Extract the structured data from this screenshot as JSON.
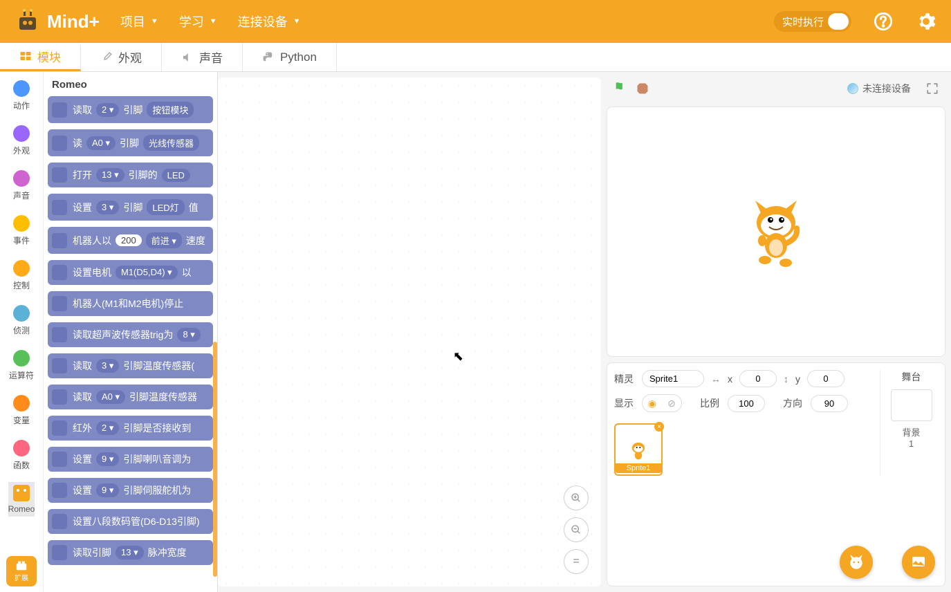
{
  "app": {
    "name": "Mind+"
  },
  "menu": {
    "project": "项目",
    "learn": "学习",
    "connect": "连接设备"
  },
  "toggle": {
    "realtime": "实时执行"
  },
  "tabs": {
    "blocks": "模块",
    "costumes": "外观",
    "sounds": "声音",
    "python": "Python"
  },
  "categories": [
    {
      "name": "动作",
      "color": "#4c97ff"
    },
    {
      "name": "外观",
      "color": "#9966ff"
    },
    {
      "name": "声音",
      "color": "#cf63cf"
    },
    {
      "name": "事件",
      "color": "#ffbf00"
    },
    {
      "name": "控制",
      "color": "#ffab19"
    },
    {
      "name": "侦测",
      "color": "#5cb1d6"
    },
    {
      "name": "运算符",
      "color": "#59c059"
    },
    {
      "name": "变量",
      "color": "#ff8c1a"
    },
    {
      "name": "函数",
      "color": "#ff6680"
    },
    {
      "name": "Romeo",
      "color": "#f5a623"
    }
  ],
  "extension_button": "扩展",
  "palette": {
    "title": "Romeo",
    "blocks": [
      {
        "p1": "读取",
        "b1": "2",
        "p2": "引脚",
        "b2": "按钮模块"
      },
      {
        "p1": "读",
        "b1": "A0",
        "p2": "引脚",
        "b2": "光线传感器"
      },
      {
        "p1": "打开",
        "b1": "13",
        "p2": "引脚的",
        "b2": "LED"
      },
      {
        "p1": "设置",
        "b1": "3",
        "p2": "引脚",
        "b2": "LED灯",
        "p3": "值"
      },
      {
        "p1": "机器人以",
        "o1": "200",
        "p2": "速度",
        "b1": "前进"
      },
      {
        "p1": "设置电机",
        "b1": "M1(D5,D4)",
        "p2": "以"
      },
      {
        "p1": "机器人(M1和M2电机)停止"
      },
      {
        "p1": "读取超声波传感器trig为",
        "b1": "8"
      },
      {
        "p1": "读取",
        "b1": "3",
        "p2": "引脚温度传感器("
      },
      {
        "p1": "读取",
        "b1": "A0",
        "p2": "引脚温度传感器"
      },
      {
        "p1": "红外",
        "b1": "2",
        "p2": "引脚是否接收到"
      },
      {
        "p1": "设置",
        "b1": "9",
        "p2": "引脚喇叭音调为"
      },
      {
        "p1": "设置",
        "b1": "9",
        "p2": "引脚伺服舵机为"
      },
      {
        "p1": "设置八段数码管(D6-D13引脚)"
      },
      {
        "p1": "读取引脚",
        "b1": "13",
        "p2": "脉冲宽度"
      }
    ]
  },
  "connection_status": "未连接设备",
  "sprite_panel": {
    "sprite_label": "精灵",
    "sprite_name": "Sprite1",
    "x_label": "x",
    "x_val": "0",
    "y_label": "y",
    "y_val": "0",
    "show_label": "显示",
    "size_label": "比例",
    "size_val": "100",
    "dir_label": "方向",
    "dir_val": "90",
    "stage_label": "舞台",
    "backdrop_label": "背景",
    "backdrop_count": "1"
  },
  "sprite_card": {
    "name": "Sprite1"
  }
}
